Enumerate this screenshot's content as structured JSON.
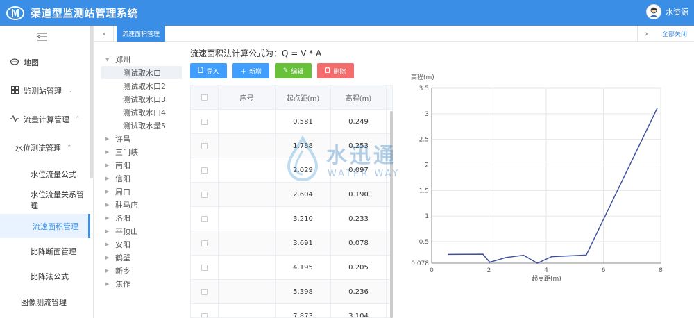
{
  "app": {
    "title": "渠道型监测站管理系统",
    "user_name": "水资源"
  },
  "sidebar": {
    "items": [
      {
        "label": "地图",
        "icon": "chat-icon",
        "arrow": ""
      },
      {
        "label": "监测站管理",
        "icon": "apps-icon",
        "arrow": "⌄"
      },
      {
        "label": "流量计算管理",
        "icon": "pulse-icon",
        "arrow": "⌃"
      },
      {
        "label": "水位测流管理",
        "icon": "",
        "arrow": "⌃"
      },
      {
        "label": "水位流量公式",
        "icon": "",
        "arrow": ""
      },
      {
        "label": "水位流量关系管理",
        "icon": "",
        "arrow": ""
      },
      {
        "label": "流速面积管理",
        "icon": "",
        "arrow": ""
      },
      {
        "label": "比降断面管理",
        "icon": "",
        "arrow": ""
      },
      {
        "label": "比降法公式",
        "icon": "",
        "arrow": ""
      },
      {
        "label": "图像测流管理",
        "icon": "",
        "arrow": ""
      }
    ]
  },
  "tabs": {
    "active": "流速面积管理",
    "close_all": "全部关闭",
    "prev": "‹",
    "next": "›"
  },
  "tree": {
    "root": "郑州",
    "children": [
      "测试取水口",
      "测试取水口2",
      "测试取水口3",
      "测试取水口4",
      "测试取水量5"
    ],
    "others": [
      "许昌",
      "三门峡",
      "南阳",
      "信阳",
      "周口",
      "驻马店",
      "洛阳",
      "平顶山",
      "安阳",
      "鹤壁",
      "新乡",
      "焦作"
    ]
  },
  "formula": "流速面积法计算公式为：Q = V * A",
  "buttons": {
    "import": "导入",
    "add": "新增",
    "edit": "编辑",
    "delete": "删除"
  },
  "colors": {
    "primary": "#3a8ee6",
    "add": "#409eff",
    "edit": "#67c23a",
    "delete": "#f56c6c",
    "line": "#3f51a0"
  },
  "table": {
    "headers": [
      "",
      "序号",
      "起点距(m)",
      "高程(m)"
    ],
    "rows": [
      [
        "",
        "",
        "0.581",
        "0.249"
      ],
      [
        "",
        "",
        "1.788",
        "0.253"
      ],
      [
        "",
        "",
        "2.029",
        "0.097"
      ],
      [
        "",
        "",
        "2.604",
        "0.190"
      ],
      [
        "",
        "",
        "3.210",
        "0.233"
      ],
      [
        "",
        "",
        "3.691",
        "0.078"
      ],
      [
        "",
        "",
        "4.195",
        "0.205"
      ],
      [
        "",
        "",
        "5.398",
        "0.236"
      ],
      [
        "",
        "",
        "7.873",
        "3.104"
      ]
    ]
  },
  "watermark": {
    "cn": "水迅通",
    "en": "WATER WAY"
  },
  "chart_data": {
    "type": "line",
    "ylabel": "高程(m)",
    "xlabel": "起点距(m)",
    "xlim": [
      0,
      8
    ],
    "ylim": [
      0.078,
      3.5
    ],
    "x_ticks": [
      "0",
      "2",
      "4",
      "6",
      "8"
    ],
    "y_ticks": [
      "0.078",
      "0.5",
      "1",
      "1.5",
      "2",
      "2.5",
      "3",
      "3.5"
    ],
    "y_tick_values": [
      0.078,
      0.5,
      1,
      1.5,
      2,
      2.5,
      3,
      3.5
    ],
    "x_tick_values": [
      0,
      2,
      4,
      6,
      8
    ],
    "series": [
      {
        "x": [
          0.581,
          1.788,
          2.029,
          2.604,
          3.21,
          3.691,
          4.195,
          5.398,
          7.873
        ],
        "y": [
          0.249,
          0.253,
          0.097,
          0.19,
          0.233,
          0.078,
          0.205,
          0.236,
          3.104
        ]
      }
    ],
    "grid": true
  }
}
